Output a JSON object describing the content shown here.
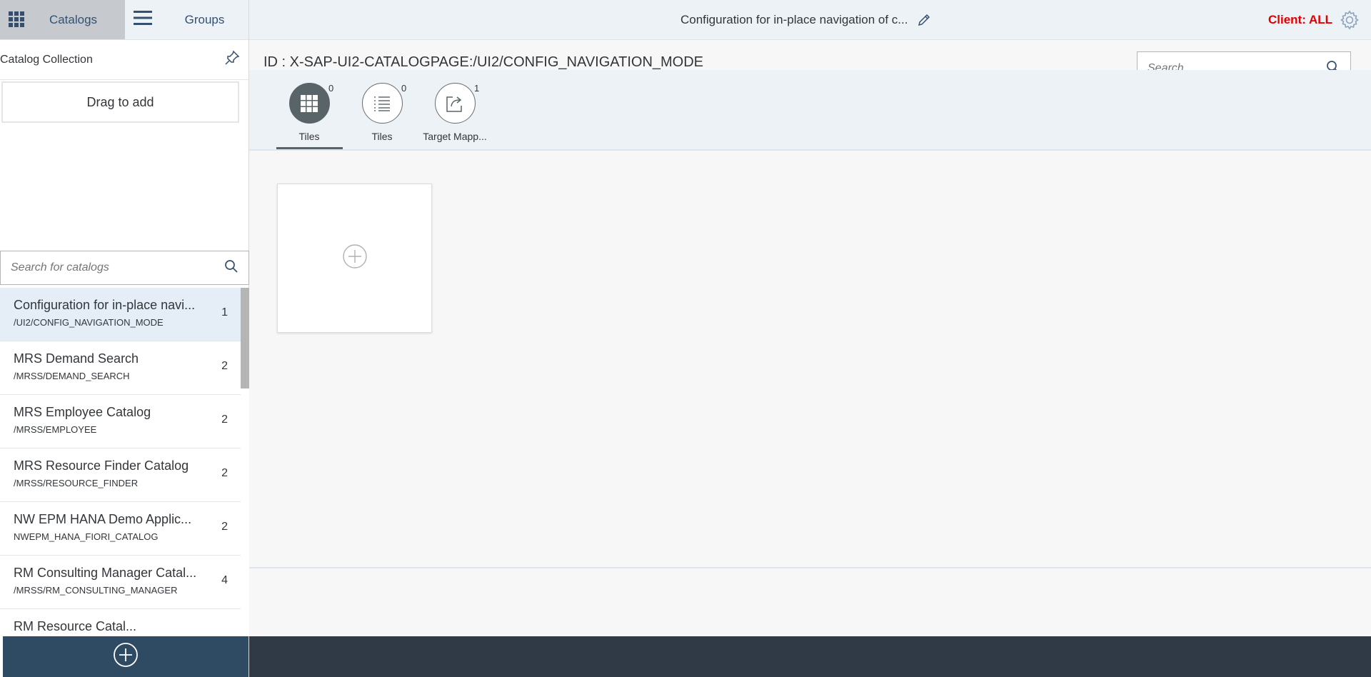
{
  "shell": {
    "nav_catalogs_label": "Catalogs",
    "nav_groups_label": "Groups",
    "page_title": "Configuration for in-place navigation of c...",
    "client_label": "Client: ALL",
    "accent_color": "#e00000"
  },
  "sidebar": {
    "collection_title": "Catalog Collection",
    "drag_label": "Drag to add",
    "search_placeholder": "Search for catalogs",
    "catalogs": [
      {
        "name": "Configuration for in-place navi...",
        "id": "/UI2/CONFIG_NAVIGATION_MODE",
        "count": "1",
        "selected": true
      },
      {
        "name": "MRS Demand Search",
        "id": "/MRSS/DEMAND_SEARCH",
        "count": "2"
      },
      {
        "name": "MRS Employee Catalog",
        "id": "/MRSS/EMPLOYEE",
        "count": "2"
      },
      {
        "name": "MRS Resource Finder Catalog",
        "id": "/MRSS/RESOURCE_FINDER",
        "count": "2"
      },
      {
        "name": "NW EPM HANA Demo Applic...",
        "id": "NWEPM_HANA_FIORI_CATALOG",
        "count": "2"
      },
      {
        "name": "RM Consulting Manager Catal...",
        "id": "/MRSS/RM_CONSULTING_MANAGER",
        "count": "4"
      },
      {
        "name": "RM Resource Catal...",
        "id": "",
        "count": ""
      }
    ]
  },
  "main": {
    "id_line": "ID : X-SAP-UI2-CATALOGPAGE:/UI2/CONFIG_NAVIGATION_MODE",
    "search_placeholder": "Search",
    "tabs": [
      {
        "label": "Tiles",
        "count": "0",
        "icon": "grid-icon",
        "active": true
      },
      {
        "label": "Tiles",
        "count": "0",
        "icon": "list-icon"
      },
      {
        "label": "Target Mapp...",
        "count": "1",
        "icon": "share-icon"
      }
    ]
  }
}
